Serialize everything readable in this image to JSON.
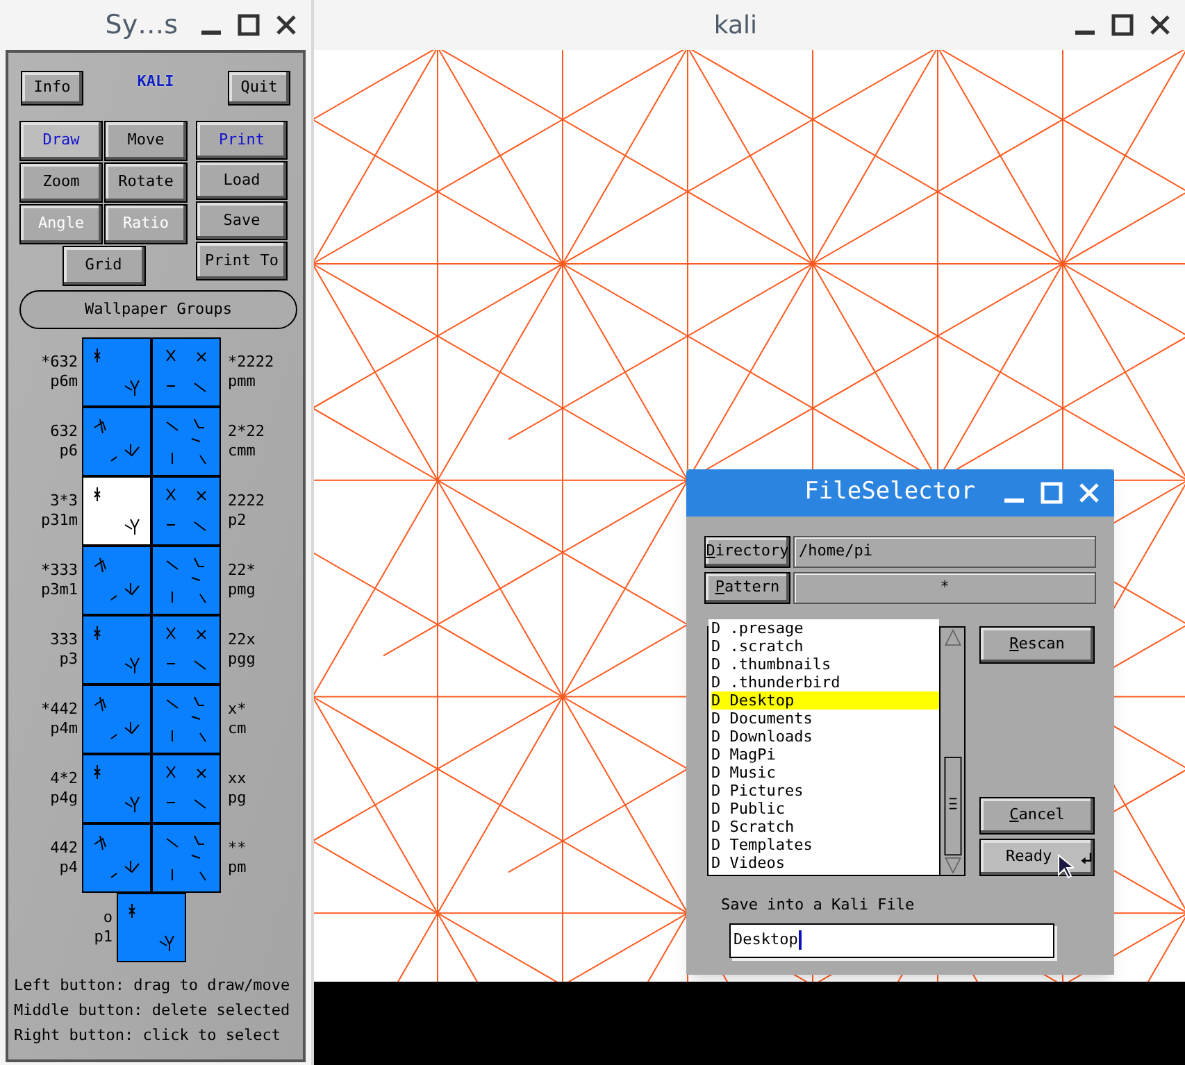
{
  "tool_window": {
    "title": "Sy…s",
    "logo": "KALI",
    "top_buttons": [
      {
        "label": "Info"
      },
      {
        "label": "Quit"
      }
    ],
    "mode_buttons": [
      {
        "label": "Draw",
        "active": true,
        "disabled": false
      },
      {
        "label": "Move",
        "active": false,
        "disabled": false
      },
      {
        "label": "Zoom",
        "active": false,
        "disabled": false
      },
      {
        "label": "Rotate",
        "active": false,
        "disabled": false
      },
      {
        "label": "Angle",
        "active": false,
        "disabled": true
      },
      {
        "label": "Ratio",
        "active": false,
        "disabled": true
      },
      {
        "label": "Grid",
        "active": false,
        "disabled": false
      }
    ],
    "file_buttons": [
      {
        "label": "Print",
        "active": true
      },
      {
        "label": "Load",
        "active": false
      },
      {
        "label": "Save",
        "active": false
      },
      {
        "label": "Print To",
        "active": false
      }
    ],
    "groups_button": "Wallpaper Groups",
    "groups": [
      {
        "notation": "*632",
        "name": "p6m",
        "selected": false
      },
      {
        "notation": "*2222",
        "name": "pmm",
        "selected": false
      },
      {
        "notation": "632",
        "name": "p6",
        "selected": false
      },
      {
        "notation": "2*22",
        "name": "cmm",
        "selected": false
      },
      {
        "notation": "3*3",
        "name": "p31m",
        "selected": true
      },
      {
        "notation": "2222",
        "name": "p2",
        "selected": false
      },
      {
        "notation": "*333",
        "name": "p3m1",
        "selected": false
      },
      {
        "notation": "22*",
        "name": "pmg",
        "selected": false
      },
      {
        "notation": "333",
        "name": "p3",
        "selected": false
      },
      {
        "notation": "22x",
        "name": "pgg",
        "selected": false
      },
      {
        "notation": "*442",
        "name": "p4m",
        "selected": false
      },
      {
        "notation": "x*",
        "name": "cm",
        "selected": false
      },
      {
        "notation": "4*2",
        "name": "p4g",
        "selected": false
      },
      {
        "notation": "xx",
        "name": "pg",
        "selected": false
      },
      {
        "notation": "442",
        "name": "p4",
        "selected": false
      },
      {
        "notation": "**",
        "name": "pm",
        "selected": false
      },
      {
        "notation": "o",
        "name": "p1",
        "selected": false
      }
    ],
    "help": [
      "Left button: drag to draw/move",
      "Middle button: delete selected",
      "Right button: click to select"
    ]
  },
  "canvas_window": {
    "title": "kali"
  },
  "file_selector": {
    "title": "FileSelector",
    "directory_button": "Directory",
    "directory": "/home/pi",
    "pattern_button": "Pattern",
    "pattern": "*",
    "files": [
      {
        "type": "D",
        "name": ".presage",
        "selected": false
      },
      {
        "type": "D",
        "name": ".scratch",
        "selected": false
      },
      {
        "type": "D",
        "name": ".thumbnails",
        "selected": false
      },
      {
        "type": "D",
        "name": ".thunderbird",
        "selected": false
      },
      {
        "type": "D",
        "name": "Desktop",
        "selected": true
      },
      {
        "type": "D",
        "name": "Documents",
        "selected": false
      },
      {
        "type": "D",
        "name": "Downloads",
        "selected": false
      },
      {
        "type": "D",
        "name": "MagPi",
        "selected": false
      },
      {
        "type": "D",
        "name": "Music",
        "selected": false
      },
      {
        "type": "D",
        "name": "Pictures",
        "selected": false
      },
      {
        "type": "D",
        "name": "Public",
        "selected": false
      },
      {
        "type": "D",
        "name": "Scratch",
        "selected": false
      },
      {
        "type": "D",
        "name": "Templates",
        "selected": false
      },
      {
        "type": "D",
        "name": "Videos",
        "selected": false
      }
    ],
    "side_buttons": [
      {
        "label": "Rescan",
        "underline_first": true
      },
      {
        "label": "Cancel",
        "underline_first": true
      },
      {
        "label": "Ready",
        "underline_first": false,
        "kind": "default"
      }
    ],
    "save_label": "Save into a Kali File",
    "filename": "Desktop"
  }
}
